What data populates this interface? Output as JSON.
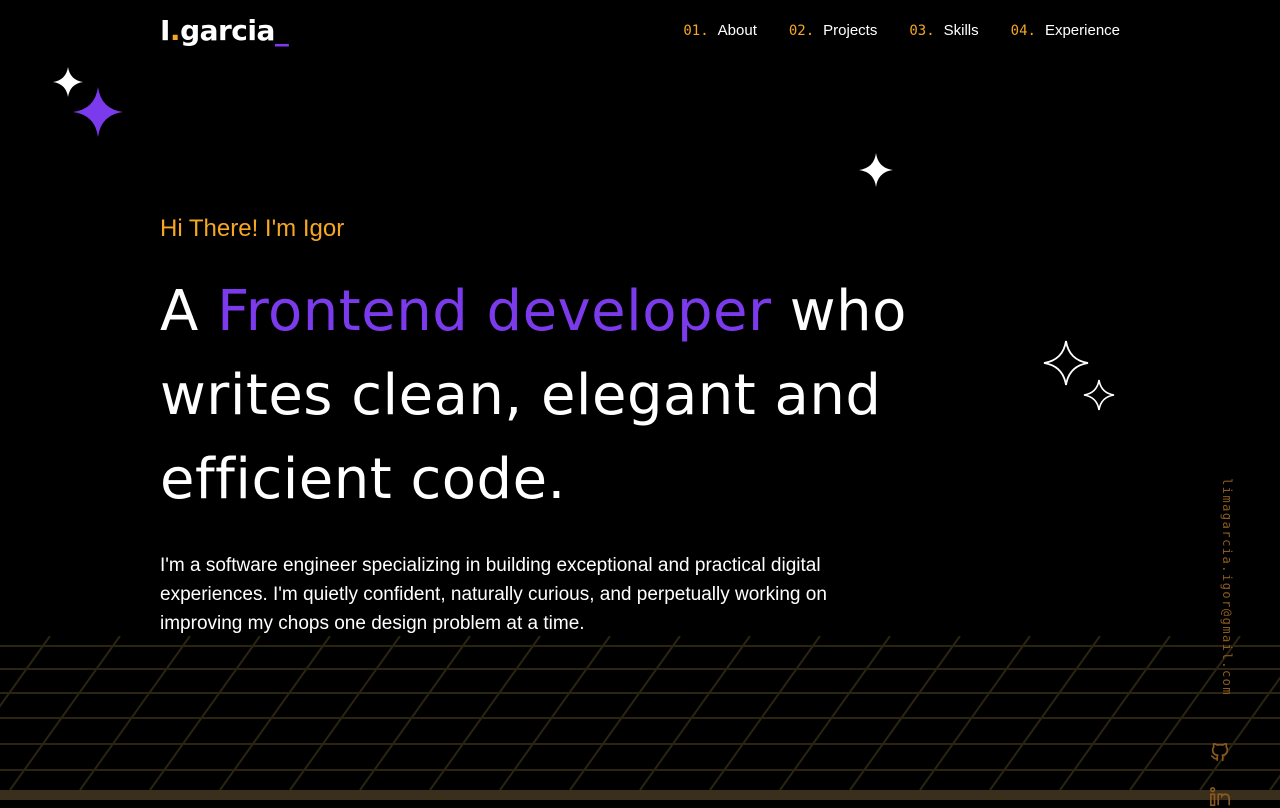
{
  "header": {
    "logo": {
      "letter": "I",
      "dot": ".",
      "name": "garcia",
      "cursor": "_"
    },
    "nav": [
      {
        "num": "01.",
        "label": "About"
      },
      {
        "num": "02.",
        "label": "Projects"
      },
      {
        "num": "03.",
        "label": "Skills"
      },
      {
        "num": "04.",
        "label": "Experience"
      }
    ]
  },
  "hero": {
    "greeting": "Hi There! I'm Igor",
    "headline_pre": "A ",
    "headline_accent": "Frontend developer",
    "headline_post": " who writes clean, elegant and efficient code.",
    "intro": "I'm a software engineer specializing in building exceptional and practical digital experiences. I'm quietly confident, naturally curious, and perpetually working on improving my chops one design problem at a time."
  },
  "sidebar": {
    "email": "limagarcia.igor@gmail.com",
    "icons": [
      "github-icon",
      "linkedin-icon"
    ]
  },
  "colors": {
    "background": "#000000",
    "accent_orange": "#f5a623",
    "accent_purple": "#7c3aed",
    "text": "#ffffff"
  }
}
